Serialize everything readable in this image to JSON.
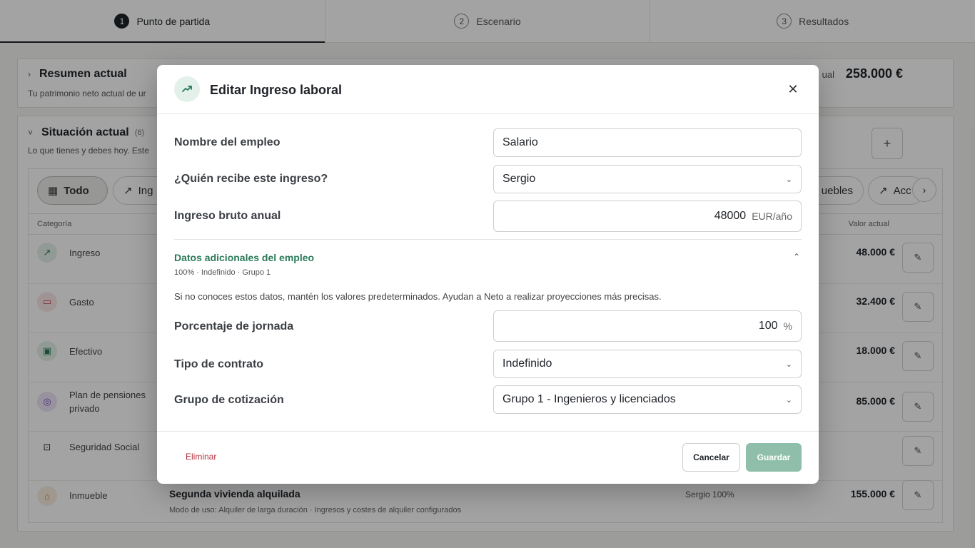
{
  "steps": [
    {
      "num": "1",
      "label": "Punto de partida"
    },
    {
      "num": "2",
      "label": "Escenario"
    },
    {
      "num": "3",
      "label": "Resultados"
    }
  ],
  "summary": {
    "title": "Resumen actual",
    "subtitle": "Tu patrimonio neto actual de ur",
    "total_label": "ual",
    "total_value": "258.000 €"
  },
  "situation": {
    "title": "Situación actual",
    "count": "(6)",
    "subtitle": "Lo que tienes y debes hoy. Este",
    "add_icon": "plus-icon",
    "filters": [
      "Todo",
      "Ing",
      "uebles",
      "Acc"
    ],
    "columns": {
      "category": "Categoría",
      "value": "Valor actual"
    },
    "rows": [
      {
        "category": "Ingreso",
        "value": "48.000 €",
        "icon": "trending-up-icon",
        "color": "#2b7a5a"
      },
      {
        "category": "Gasto",
        "value": "32.400 €",
        "icon": "money-icon",
        "color": "#c0404a"
      },
      {
        "category": "Efectivo",
        "value": "18.000 €",
        "icon": "wallet-icon",
        "color": "#2b7a5a"
      },
      {
        "category": "Plan de pensiones privado",
        "value": "85.000 €",
        "icon": "piggy-bank-icon",
        "color": "#7a4fc0"
      },
      {
        "category": "Seguridad Social",
        "value": "",
        "icon": "briefcase-icon",
        "color": "#333333"
      },
      {
        "category": "Inmueble",
        "value": "155.000 €",
        "icon": "house-icon",
        "color": "#c07a2b",
        "name": "Segunda vivienda alquilada",
        "detail": "Modo de uso: Alquiler de larga duración  ·  Ingresos y costes de alquiler configurados",
        "owner": "Sergio 100%"
      }
    ]
  },
  "modal": {
    "title": "Editar Ingreso laboral",
    "fields": {
      "job_name": {
        "label": "Nombre del empleo",
        "value": "Salario"
      },
      "recipient": {
        "label": "¿Quién recibe este ingreso?",
        "value": "Sergio"
      },
      "gross_income": {
        "label": "Ingreso bruto anual",
        "value": "48000",
        "unit": "EUR/año"
      }
    },
    "additional": {
      "title": "Datos adicionales del empleo",
      "summary": "100% · Indefinido · Grupo 1",
      "help": "Si no conoces estos datos, mantén los valores predeterminados. Ayudan a Neto a realizar proyecciones más precisas.",
      "workday": {
        "label": "Porcentaje de jornada",
        "value": "100",
        "unit": "%"
      },
      "contract": {
        "label": "Tipo de contrato",
        "value": "Indefinido"
      },
      "group": {
        "label": "Grupo de cotización",
        "value": "Grupo 1 - Ingenieros y licenciados"
      }
    },
    "buttons": {
      "delete": "Eliminar",
      "cancel": "Cancelar",
      "save": "Guardar"
    }
  }
}
